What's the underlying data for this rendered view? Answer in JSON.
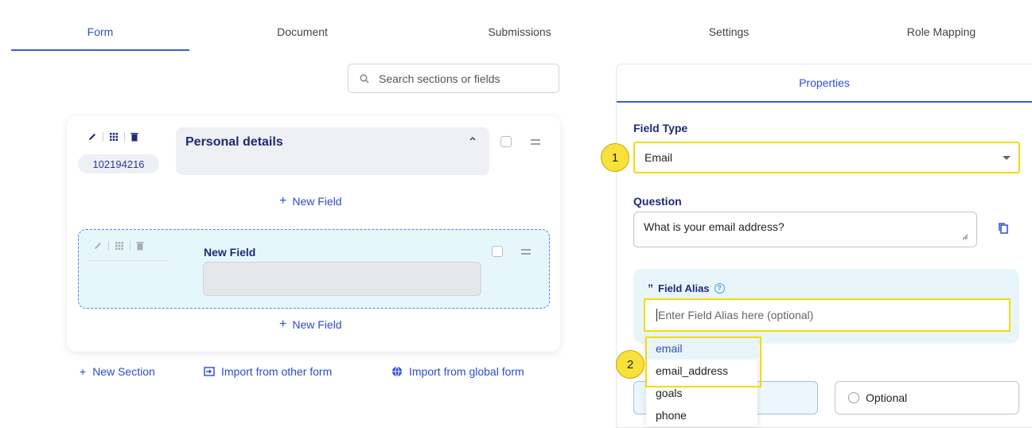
{
  "tabs": [
    {
      "label": "Form",
      "active": true
    },
    {
      "label": "Document"
    },
    {
      "label": "Submissions"
    },
    {
      "label": "Settings"
    },
    {
      "label": "Role Mapping"
    }
  ],
  "search": {
    "placeholder": "Search sections or fields"
  },
  "section": {
    "id": "102194216",
    "title": "Personal details",
    "new_field_label": "New Field",
    "field": {
      "title": "New Field"
    }
  },
  "actions": {
    "new_section": "New Section",
    "import_other": "Import from other form",
    "import_global": "Import from global form"
  },
  "properties": {
    "header": "Properties",
    "field_type_label": "Field Type",
    "field_type_value": "Email",
    "question_label": "Question",
    "question_value": "What is your email address?",
    "alias_label": "Field Alias",
    "alias_placeholder": "Enter Field Alias here (optional)",
    "suggestions": [
      "email",
      "email_address",
      "goals",
      "phone"
    ],
    "optional_label": "Optional"
  },
  "markers": [
    "1",
    "2"
  ],
  "colors": {
    "accent": "#3e5bdc",
    "highlight": "#f2dc00",
    "link": "#2b4bd0",
    "title": "#1d2a78"
  }
}
